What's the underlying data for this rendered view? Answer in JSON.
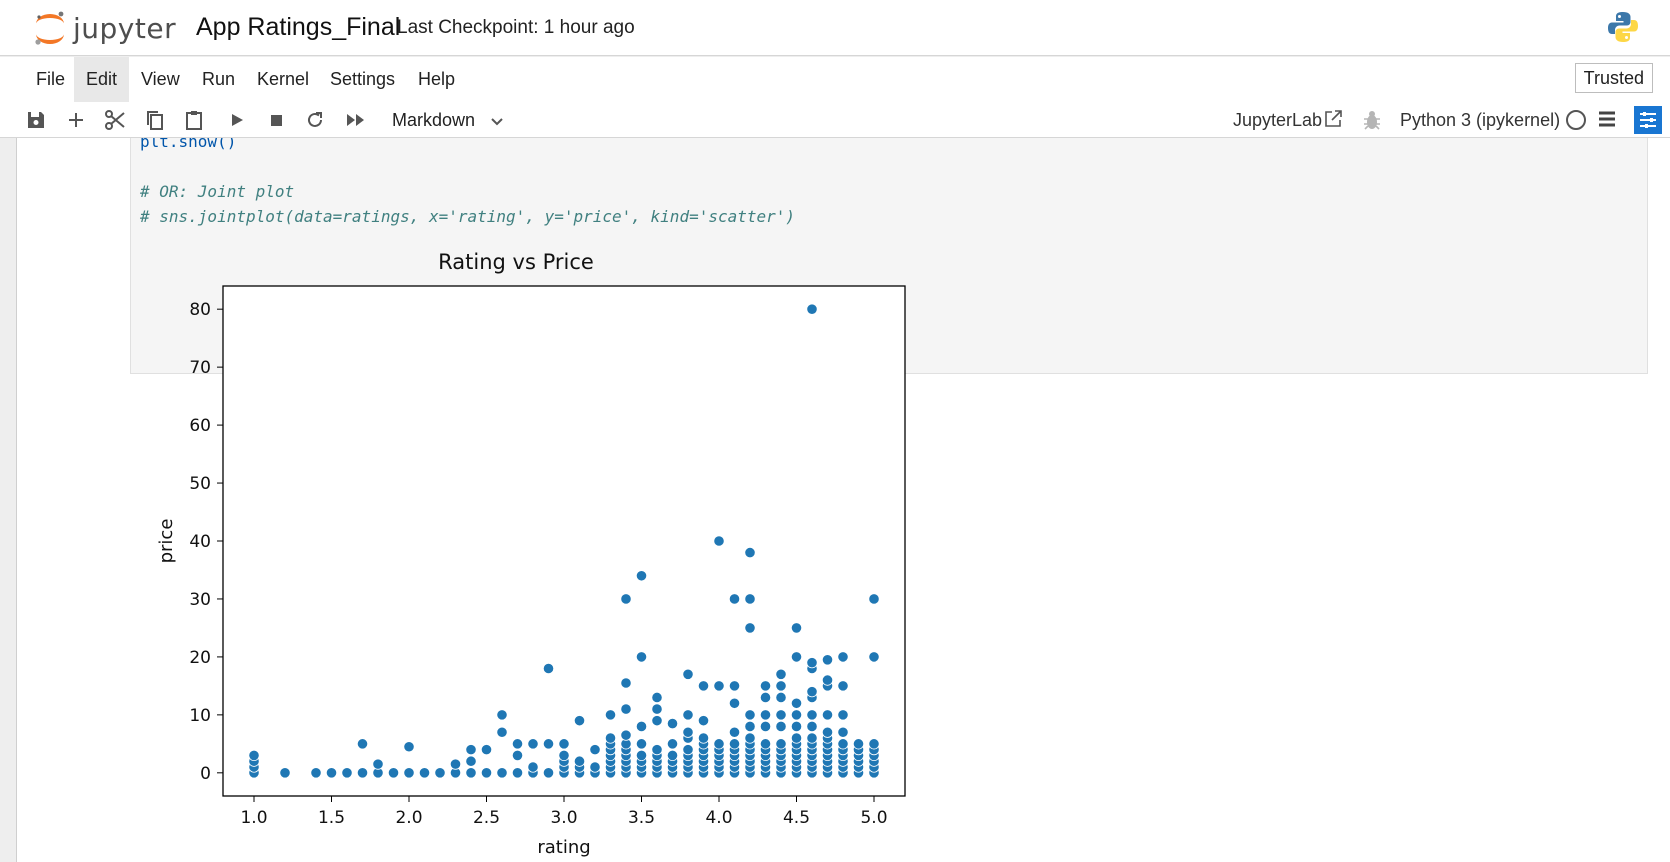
{
  "header": {
    "logo_text": "jupyter",
    "notebook_title": "App Ratings_Final",
    "checkpoint": "Last Checkpoint: 1 hour ago",
    "python_logo_icon": "python-logo-icon"
  },
  "menu": {
    "items": [
      "File",
      "Edit",
      "View",
      "Run",
      "Kernel",
      "Settings",
      "Help"
    ],
    "active": "Edit",
    "trusted_label": "Trusted"
  },
  "toolbar": {
    "icons": [
      "save-icon",
      "add-cell-icon",
      "cut-icon",
      "copy-icon",
      "paste-icon",
      "run-icon",
      "stop-icon",
      "restart-icon",
      "fast-forward-icon"
    ],
    "cell_type": "Markdown",
    "jupyterlab_label": "JupyterLab",
    "kernel_label": "Python 3 (ipykernel)"
  },
  "code_cell": {
    "lines": [
      {
        "text": "plt.show()",
        "kind": "code"
      },
      {
        "text": "",
        "kind": "blank"
      },
      {
        "text": "# OR: Joint plot",
        "kind": "comment"
      },
      {
        "text": "# sns.jointplot(data=ratings, x='rating', y='price', kind='scatter')",
        "kind": "comment"
      }
    ]
  },
  "chart_data": {
    "type": "scatter",
    "title": "Rating vs Price",
    "xlabel": "rating",
    "ylabel": "price",
    "xlim": [
      0.8,
      5.2
    ],
    "ylim": [
      -4,
      84
    ],
    "xticks": [
      "1.0",
      "1.5",
      "2.0",
      "2.5",
      "3.0",
      "3.5",
      "4.0",
      "4.5",
      "5.0"
    ],
    "yticks": [
      "0",
      "10",
      "20",
      "30",
      "40",
      "50",
      "60",
      "70",
      "80"
    ],
    "grid": false,
    "color": "#1f77b4",
    "points": [
      [
        1.0,
        0
      ],
      [
        1.0,
        1
      ],
      [
        1.0,
        2
      ],
      [
        1.0,
        3
      ],
      [
        1.2,
        0
      ],
      [
        1.4,
        0
      ],
      [
        1.5,
        0
      ],
      [
        1.6,
        0
      ],
      [
        1.7,
        0
      ],
      [
        1.7,
        5
      ],
      [
        1.8,
        0
      ],
      [
        1.8,
        1.5
      ],
      [
        1.9,
        0
      ],
      [
        2.0,
        0
      ],
      [
        2.0,
        4.5
      ],
      [
        2.1,
        0
      ],
      [
        2.2,
        0
      ],
      [
        2.3,
        0
      ],
      [
        2.3,
        1.5
      ],
      [
        2.4,
        0
      ],
      [
        2.4,
        2
      ],
      [
        2.4,
        4
      ],
      [
        2.5,
        0
      ],
      [
        2.5,
        4
      ],
      [
        2.6,
        0
      ],
      [
        2.6,
        7
      ],
      [
        2.6,
        10
      ],
      [
        2.7,
        0
      ],
      [
        2.7,
        3
      ],
      [
        2.7,
        5
      ],
      [
        2.8,
        0
      ],
      [
        2.8,
        1
      ],
      [
        2.8,
        5
      ],
      [
        2.9,
        0
      ],
      [
        2.9,
        5
      ],
      [
        2.9,
        18
      ],
      [
        3.0,
        0
      ],
      [
        3.0,
        1
      ],
      [
        3.0,
        2
      ],
      [
        3.0,
        3
      ],
      [
        3.0,
        5
      ],
      [
        3.1,
        0
      ],
      [
        3.1,
        1
      ],
      [
        3.1,
        2
      ],
      [
        3.1,
        9
      ],
      [
        3.2,
        0
      ],
      [
        3.2,
        1
      ],
      [
        3.2,
        4
      ],
      [
        3.3,
        0
      ],
      [
        3.3,
        1
      ],
      [
        3.3,
        2
      ],
      [
        3.3,
        3
      ],
      [
        3.3,
        4
      ],
      [
        3.3,
        5
      ],
      [
        3.3,
        6
      ],
      [
        3.3,
        10
      ],
      [
        3.4,
        0
      ],
      [
        3.4,
        1
      ],
      [
        3.4,
        2
      ],
      [
        3.4,
        3
      ],
      [
        3.4,
        4
      ],
      [
        3.4,
        5
      ],
      [
        3.4,
        6.5
      ],
      [
        3.4,
        11
      ],
      [
        3.4,
        15.5
      ],
      [
        3.4,
        30
      ],
      [
        3.5,
        0
      ],
      [
        3.5,
        1
      ],
      [
        3.5,
        2
      ],
      [
        3.5,
        3
      ],
      [
        3.5,
        5
      ],
      [
        3.5,
        8
      ],
      [
        3.5,
        20
      ],
      [
        3.5,
        34
      ],
      [
        3.6,
        0
      ],
      [
        3.6,
        1
      ],
      [
        3.6,
        2
      ],
      [
        3.6,
        3
      ],
      [
        3.6,
        4
      ],
      [
        3.6,
        9
      ],
      [
        3.6,
        11
      ],
      [
        3.6,
        13
      ],
      [
        3.7,
        0
      ],
      [
        3.7,
        1
      ],
      [
        3.7,
        2
      ],
      [
        3.7,
        3
      ],
      [
        3.7,
        5
      ],
      [
        3.7,
        8.5
      ],
      [
        3.8,
        0
      ],
      [
        3.8,
        1
      ],
      [
        3.8,
        2
      ],
      [
        3.8,
        3
      ],
      [
        3.8,
        4
      ],
      [
        3.8,
        6
      ],
      [
        3.8,
        7
      ],
      [
        3.8,
        10
      ],
      [
        3.8,
        17
      ],
      [
        3.9,
        0
      ],
      [
        3.9,
        1
      ],
      [
        3.9,
        2
      ],
      [
        3.9,
        3
      ],
      [
        3.9,
        4
      ],
      [
        3.9,
        5
      ],
      [
        3.9,
        6
      ],
      [
        3.9,
        9
      ],
      [
        3.9,
        15
      ],
      [
        4.0,
        0
      ],
      [
        4.0,
        1
      ],
      [
        4.0,
        2
      ],
      [
        4.0,
        3
      ],
      [
        4.0,
        4
      ],
      [
        4.0,
        5
      ],
      [
        4.0,
        15
      ],
      [
        4.0,
        40
      ],
      [
        4.1,
        0
      ],
      [
        4.1,
        1
      ],
      [
        4.1,
        2
      ],
      [
        4.1,
        3
      ],
      [
        4.1,
        4
      ],
      [
        4.1,
        5
      ],
      [
        4.1,
        7
      ],
      [
        4.1,
        12
      ],
      [
        4.1,
        15
      ],
      [
        4.1,
        30
      ],
      [
        4.2,
        0
      ],
      [
        4.2,
        1
      ],
      [
        4.2,
        2
      ],
      [
        4.2,
        3
      ],
      [
        4.2,
        4
      ],
      [
        4.2,
        5
      ],
      [
        4.2,
        6
      ],
      [
        4.2,
        8
      ],
      [
        4.2,
        10
      ],
      [
        4.2,
        25
      ],
      [
        4.2,
        30
      ],
      [
        4.2,
        38
      ],
      [
        4.3,
        0
      ],
      [
        4.3,
        1
      ],
      [
        4.3,
        2
      ],
      [
        4.3,
        3
      ],
      [
        4.3,
        4
      ],
      [
        4.3,
        5
      ],
      [
        4.3,
        8
      ],
      [
        4.3,
        10
      ],
      [
        4.3,
        13
      ],
      [
        4.3,
        15
      ],
      [
        4.4,
        0
      ],
      [
        4.4,
        1
      ],
      [
        4.4,
        2
      ],
      [
        4.4,
        3
      ],
      [
        4.4,
        4
      ],
      [
        4.4,
        5
      ],
      [
        4.4,
        8
      ],
      [
        4.4,
        10
      ],
      [
        4.4,
        13
      ],
      [
        4.4,
        15
      ],
      [
        4.4,
        17
      ],
      [
        4.5,
        0
      ],
      [
        4.5,
        1
      ],
      [
        4.5,
        2
      ],
      [
        4.5,
        3
      ],
      [
        4.5,
        4
      ],
      [
        4.5,
        5
      ],
      [
        4.5,
        6
      ],
      [
        4.5,
        8
      ],
      [
        4.5,
        10
      ],
      [
        4.5,
        12
      ],
      [
        4.5,
        20
      ],
      [
        4.5,
        25
      ],
      [
        4.6,
        0
      ],
      [
        4.6,
        1
      ],
      [
        4.6,
        2
      ],
      [
        4.6,
        3
      ],
      [
        4.6,
        4
      ],
      [
        4.6,
        5
      ],
      [
        4.6,
        6
      ],
      [
        4.6,
        8
      ],
      [
        4.6,
        10
      ],
      [
        4.6,
        13
      ],
      [
        4.6,
        14
      ],
      [
        4.6,
        18
      ],
      [
        4.6,
        19
      ],
      [
        4.6,
        80
      ],
      [
        4.7,
        0
      ],
      [
        4.7,
        1
      ],
      [
        4.7,
        2
      ],
      [
        4.7,
        3
      ],
      [
        4.7,
        4
      ],
      [
        4.7,
        5
      ],
      [
        4.7,
        6
      ],
      [
        4.7,
        7
      ],
      [
        4.7,
        10
      ],
      [
        4.7,
        15
      ],
      [
        4.7,
        16
      ],
      [
        4.7,
        19.5
      ],
      [
        4.8,
        0
      ],
      [
        4.8,
        1
      ],
      [
        4.8,
        2
      ],
      [
        4.8,
        3
      ],
      [
        4.8,
        4
      ],
      [
        4.8,
        5
      ],
      [
        4.8,
        7
      ],
      [
        4.8,
        10
      ],
      [
        4.8,
        15
      ],
      [
        4.8,
        20
      ],
      [
        4.9,
        0
      ],
      [
        4.9,
        1
      ],
      [
        4.9,
        2
      ],
      [
        4.9,
        3
      ],
      [
        4.9,
        4
      ],
      [
        4.9,
        5
      ],
      [
        5.0,
        0
      ],
      [
        5.0,
        1
      ],
      [
        5.0,
        2
      ],
      [
        5.0,
        3
      ],
      [
        5.0,
        4
      ],
      [
        5.0,
        5
      ],
      [
        5.0,
        20
      ],
      [
        5.0,
        30
      ]
    ]
  }
}
